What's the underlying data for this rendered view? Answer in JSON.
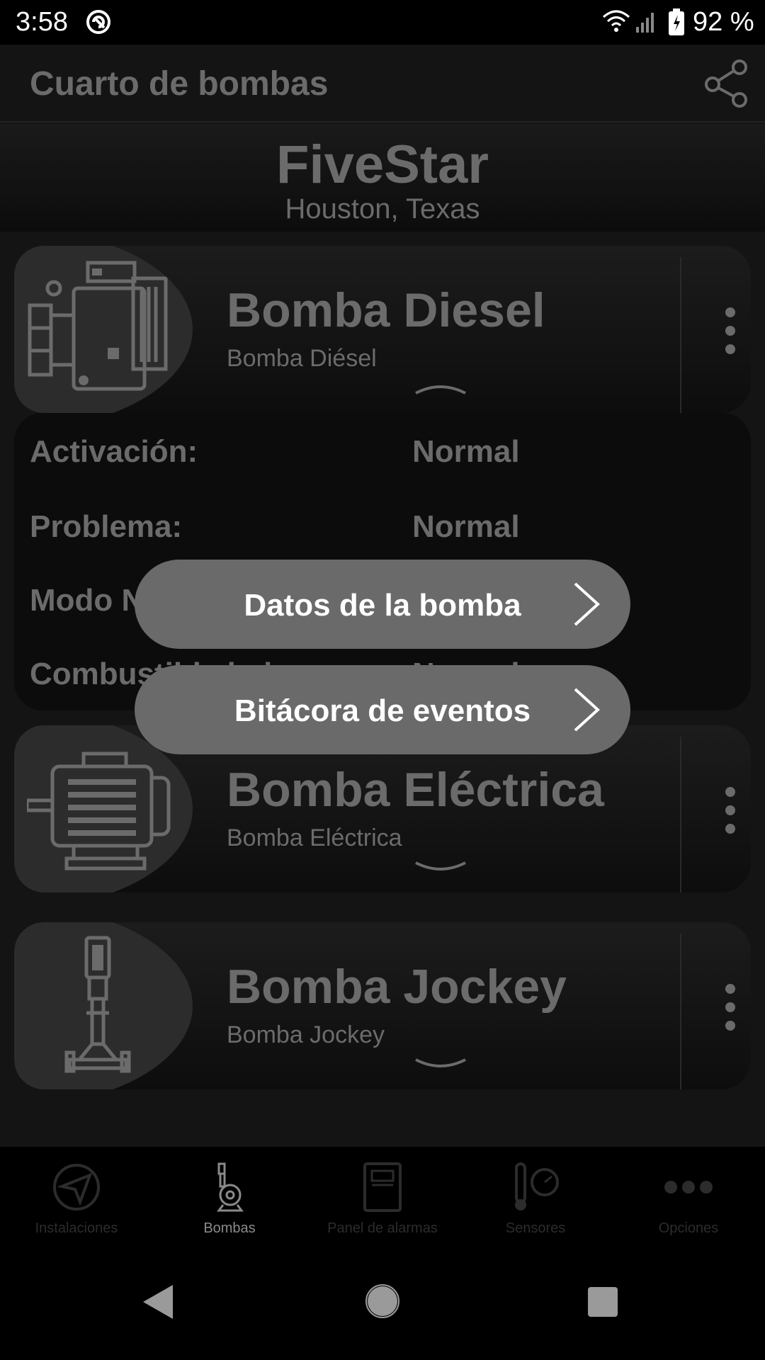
{
  "status_bar": {
    "time": "3:58",
    "battery": "92 %"
  },
  "header": {
    "title": "Cuarto de bombas"
  },
  "site": {
    "name": "FiveStar",
    "location": "Houston, Texas"
  },
  "pumps": [
    {
      "name": "Bomba Diesel",
      "subtitle": "Bomba Diésel",
      "image_icon": "diesel-engine-icon",
      "expanded": true
    },
    {
      "name": "Bomba Eléctrica",
      "subtitle": "Bomba Eléctrica",
      "image_icon": "electric-motor-icon",
      "expanded": false
    },
    {
      "name": "Bomba Jockey",
      "subtitle": "Bomba Jockey",
      "image_icon": "jockey-pump-icon",
      "expanded": false
    }
  ],
  "details": [
    {
      "label": "Activación:",
      "value": "Normal"
    },
    {
      "label": "Problema:",
      "value": "Normal"
    },
    {
      "label": "Modo N",
      "value": ""
    },
    {
      "label": "Combustible bajo:",
      "value": "Normal"
    }
  ],
  "actions": [
    {
      "label": "Datos de la bomba"
    },
    {
      "label": "Bitácora de eventos"
    }
  ],
  "bottom_nav": [
    {
      "label": "Instalaciones",
      "icon": "paper-plane-icon",
      "active": false
    },
    {
      "label": "Bombas",
      "icon": "pump-icon",
      "active": true
    },
    {
      "label": "Panel de alarmas",
      "icon": "alarm-panel-icon",
      "active": false
    },
    {
      "label": "Sensores",
      "icon": "thermometer-gauge-icon",
      "active": false
    },
    {
      "label": "Opciones",
      "icon": "more-dots-icon",
      "active": false
    }
  ],
  "colors": {
    "accent_gray": "#6b6b6b",
    "button_bg": "#6a6a6a",
    "active_nav": "#8a8a8a"
  }
}
